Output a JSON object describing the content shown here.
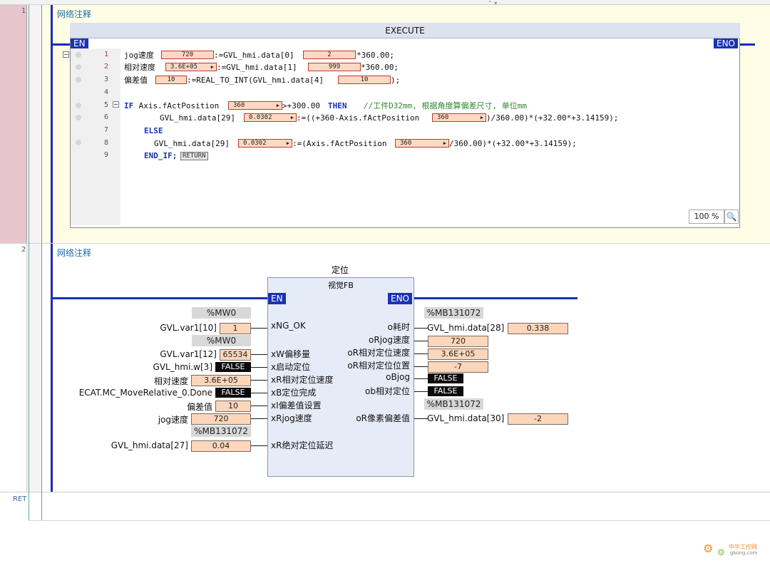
{
  "rungs": [
    {
      "number": "1",
      "comment": "网络注释"
    },
    {
      "number": "2",
      "comment": "网络注释"
    }
  ],
  "ret_label": "RET",
  "execute": {
    "title": "EXECUTE",
    "en": "EN",
    "eno": "ENO",
    "zoom": "100 %",
    "line_numbers": [
      "1",
      "2",
      "3",
      "4",
      "5",
      "6",
      "7",
      "8",
      "9"
    ],
    "lines": {
      "l1_a": "jog速度",
      "l1_b": ":=GVL_hmi.data[0]",
      "l1_c": "*360.00;",
      "l2_a": "相对速度",
      "l2_b": ":=GVL_hmi.data[1]",
      "l2_c": "*360.00;",
      "l3_a": "偏差值",
      "l3_b": ":=REAL_TO_INT(GVL_hmi.data[4]",
      "l3_c": ");",
      "l5_if": "IF",
      "l5_a": " Axis.fActPosition",
      "l5_b": ">+300.00 ",
      "l5_then": "THEN",
      "l5_cm": "   //工件D32mm, 根据角度算偏差尺寸, 单位mm",
      "l6_a": "GVL_hmi.data[29]",
      "l6_b": ":=((+360-Axis.fActPosition",
      "l6_c": ")/360.00)*(+32.00*+3.14159);",
      "l7": "ELSE",
      "l8_a": "GVL_hmi.data[29]",
      "l8_b": ":=(Axis.fActPosition",
      "l8_c": "/360.00)*(+32.00*+3.14159);",
      "l9": "END_IF;",
      "return": "RETURN"
    },
    "values": {
      "jog_speed": "720",
      "data0": "2",
      "rel_speed": "3.6E+05",
      "data1": "999",
      "offset": "10",
      "data4": "10",
      "pos5": "360",
      "data29_6": "0.0302",
      "pos6": "360",
      "data29_8": "0.0302",
      "pos8": "360"
    }
  },
  "fb": {
    "title": "定位",
    "type": "视觉FB",
    "en": "EN",
    "eno": "ENO",
    "inputs": [
      {
        "pin": "xNG_OK",
        "var": "GVL.var1[10]",
        "value": "1",
        "addr": "%MW0"
      },
      {
        "pin": "xW偏移量",
        "var": "GVL.var1[12]",
        "value": "65534",
        "addr": "%MW0"
      },
      {
        "pin": "x启动定位",
        "var": "GVL_hmi.w[3]",
        "value": "FALSE"
      },
      {
        "pin": "xR相对定位速度",
        "var": "相对速度",
        "value": "3.6E+05"
      },
      {
        "pin": "xB定位完成",
        "var": "ECAT.MC_MoveRelative_0.Done",
        "value": "FALSE"
      },
      {
        "pin": "xI偏差值设置",
        "var": "偏差值",
        "value": "10"
      },
      {
        "pin": "xRjog速度",
        "var": "jog速度",
        "value": "720"
      },
      {
        "pin": "xR绝对定位延迟",
        "var": "GVL_hmi.data[27]",
        "value": "0.04",
        "addr": "%MB131072"
      }
    ],
    "outputs": [
      {
        "pin": "o耗时",
        "var": "GVL_hmi.data[28]",
        "value": "0.338",
        "addr": "%MB131072"
      },
      {
        "pin": "oRjog速度",
        "value": "720"
      },
      {
        "pin": "oR相对定位速度",
        "value": "3.6E+05"
      },
      {
        "pin": "oR相对定位位置",
        "value": "-7"
      },
      {
        "pin": "oBjog",
        "value": "FALSE"
      },
      {
        "pin": "ob相对定位",
        "value": "FALSE"
      },
      {
        "pin": "oR像素偏差值",
        "var": "GVL_hmi.data[30]",
        "value": "-2",
        "addr": "%MB131072"
      }
    ]
  },
  "watermark": {
    "name": "中华工控网",
    "url": "gkong.com"
  },
  "colors": {
    "rail": "#1b2bb8",
    "value_box": "#fcd6bb",
    "fb_body": "#e6ecf7",
    "rung_bg": "#fffde6",
    "gutter_mark": "#e6c6cc"
  }
}
